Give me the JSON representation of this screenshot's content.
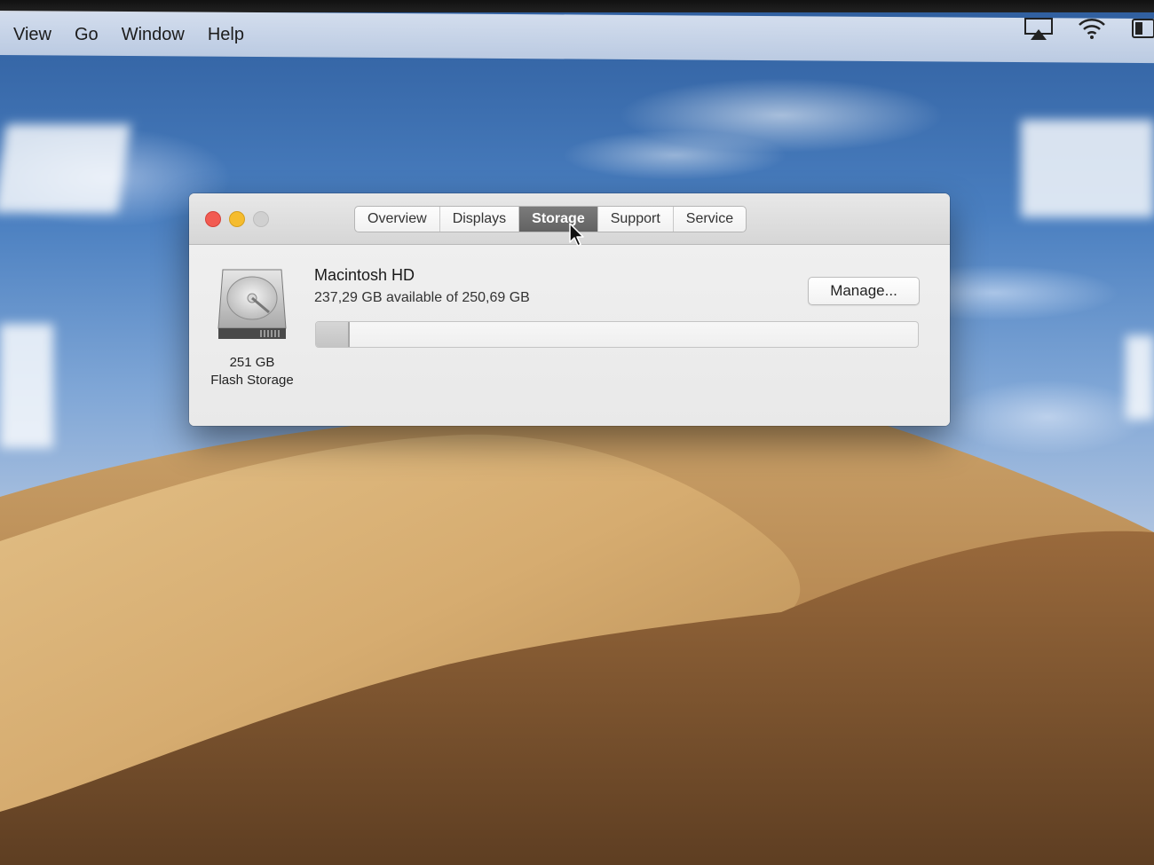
{
  "menubar": {
    "items": [
      {
        "label": "View"
      },
      {
        "label": "Go"
      },
      {
        "label": "Window"
      },
      {
        "label": "Help"
      }
    ],
    "status_icons": [
      "airplay-icon",
      "wifi-icon",
      "battery-icon"
    ]
  },
  "window": {
    "traffic_lights": [
      "close",
      "minimize",
      "zoom"
    ],
    "tabs": [
      {
        "label": "Overview",
        "active": false
      },
      {
        "label": "Displays",
        "active": false
      },
      {
        "label": "Storage",
        "active": true
      },
      {
        "label": "Support",
        "active": false
      },
      {
        "label": "Service",
        "active": false
      }
    ],
    "disk": {
      "icon": "hard-drive-icon",
      "size_label": "251 GB",
      "type_label": "Flash Storage"
    },
    "volume": {
      "name": "Macintosh HD",
      "availability": "237,29 GB available of 250,69 GB",
      "used_fraction": 0.0535
    },
    "manage_label": "Manage..."
  },
  "colors": {
    "close": "#f25b52",
    "minimize": "#f5bc2e",
    "zoom": "#d0d0d0",
    "active_tab": "#6e6e6e"
  }
}
